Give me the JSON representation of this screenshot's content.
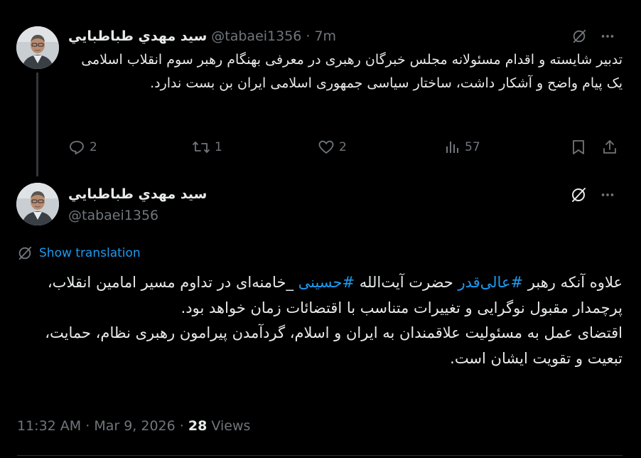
{
  "tweet1": {
    "display_name": "سيد مهدي طباطبايي",
    "handle": "@tabaei1356",
    "separator": "·",
    "time": "7m",
    "text": "تدبیر شایسته و اقدام مسئولانه مجلس خبرگان رهبری در معرفی بهنگام رهبر سوم  انقلاب اسلامی یک پیام واضح و آشکار داشت، ساختار سیاسی جمهوری اسلامی ایران بن بست ندارد.",
    "replies": "2",
    "reposts": "1",
    "likes": "2",
    "views": "57",
    "icons": {
      "grok": "grok-icon",
      "more": "more-icon",
      "reply": "reply-icon",
      "repost": "repost-icon",
      "like": "heart-icon",
      "views": "views-icon",
      "bookmark": "bookmark-icon",
      "share": "share-icon"
    }
  },
  "tweet2": {
    "display_name": "سيد مهدي طباطبايي",
    "handle": "@tabaei1356",
    "show_translation": "Show translation",
    "text_part1": "علاوه آنکه رهبر ",
    "hashtag1": "#عالی‌قدر",
    "text_part2": " حضرت آیت‌الله ",
    "hashtag2": "#حسینی",
    "text_part3": " _خامنه‌ای در تداوم مسیر امامین انقلاب، پرچمدار مقبول نوگرایی و تغییرات متناسب با اقتضائات زمان خواهد بود.",
    "text_para2": "اقتضای عمل به مسئولیت علاقمندان به ایران و اسلام، گردآمدن پیرامون رهبری نظام، حمایت، تبعیت و تقویت ایشان است.",
    "time": "11:32 AM",
    "date": "Mar 9, 2026",
    "dot": "·",
    "views_count": "28",
    "views_label": "Views"
  },
  "colors": {
    "background": "#000000",
    "text": "#e7e9ea",
    "muted": "#71767b",
    "link": "#1d9bf0",
    "thread_line": "#333639"
  }
}
